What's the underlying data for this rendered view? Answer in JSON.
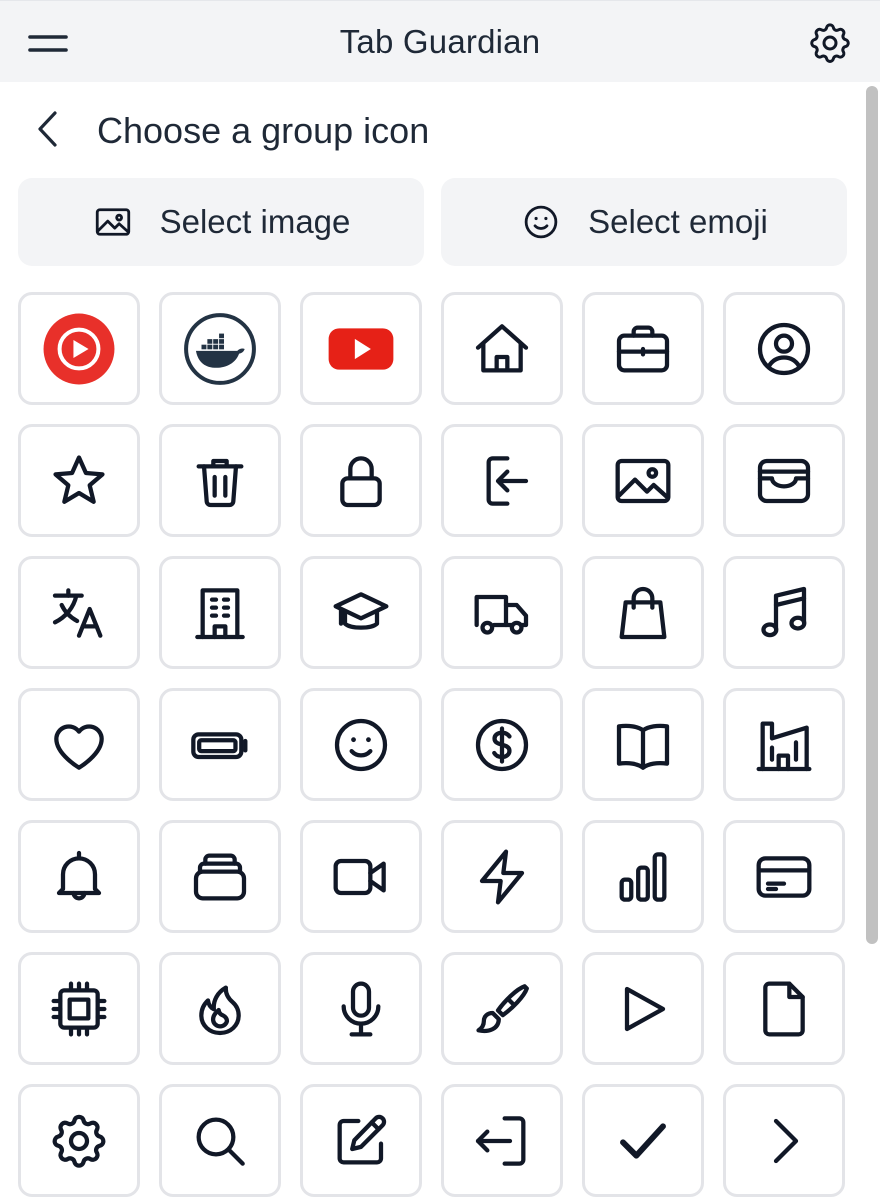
{
  "header": {
    "title": "Tab Guardian",
    "menu_icon": "hamburger-menu-icon",
    "settings_icon": "gear-icon"
  },
  "subheader": {
    "back_icon": "chevron-left-icon",
    "title": "Choose a group icon"
  },
  "actions": {
    "select_image": {
      "label": "Select image",
      "icon": "image-icon"
    },
    "select_emoji": {
      "label": "Select emoji",
      "icon": "smiley-icon"
    }
  },
  "colors": {
    "header_bg": "#f3f4f6",
    "button_bg": "#f3f4f6",
    "tile_border": "#e3e4e8",
    "icon_stroke": "#111827",
    "youtube_music_red": "#e8302a",
    "youtube_red": "#e62117",
    "docker_navy": "#233344"
  },
  "icons": [
    "youtube-music-icon",
    "docker-icon",
    "youtube-icon",
    "home-icon",
    "briefcase-icon",
    "user-circle-icon",
    "star-icon",
    "trash-icon",
    "lock-icon",
    "login-icon",
    "photo-icon",
    "wallet-icon",
    "language-icon",
    "building-icon",
    "graduation-cap-icon",
    "truck-icon",
    "shopping-bag-icon",
    "music-note-icon",
    "heart-icon",
    "battery-icon",
    "smiley-icon",
    "dollar-coin-icon",
    "book-open-icon",
    "factory-icon",
    "bell-icon",
    "stack-icon",
    "video-camera-icon",
    "bolt-icon",
    "bar-chart-icon",
    "credit-card-icon",
    "cpu-chip-icon",
    "fire-icon",
    "microphone-icon",
    "paint-brush-icon",
    "play-icon",
    "document-icon",
    "settings-icon",
    "search-icon",
    "edit-icon",
    "logout-icon",
    "check-icon",
    "chevron-right-icon"
  ]
}
